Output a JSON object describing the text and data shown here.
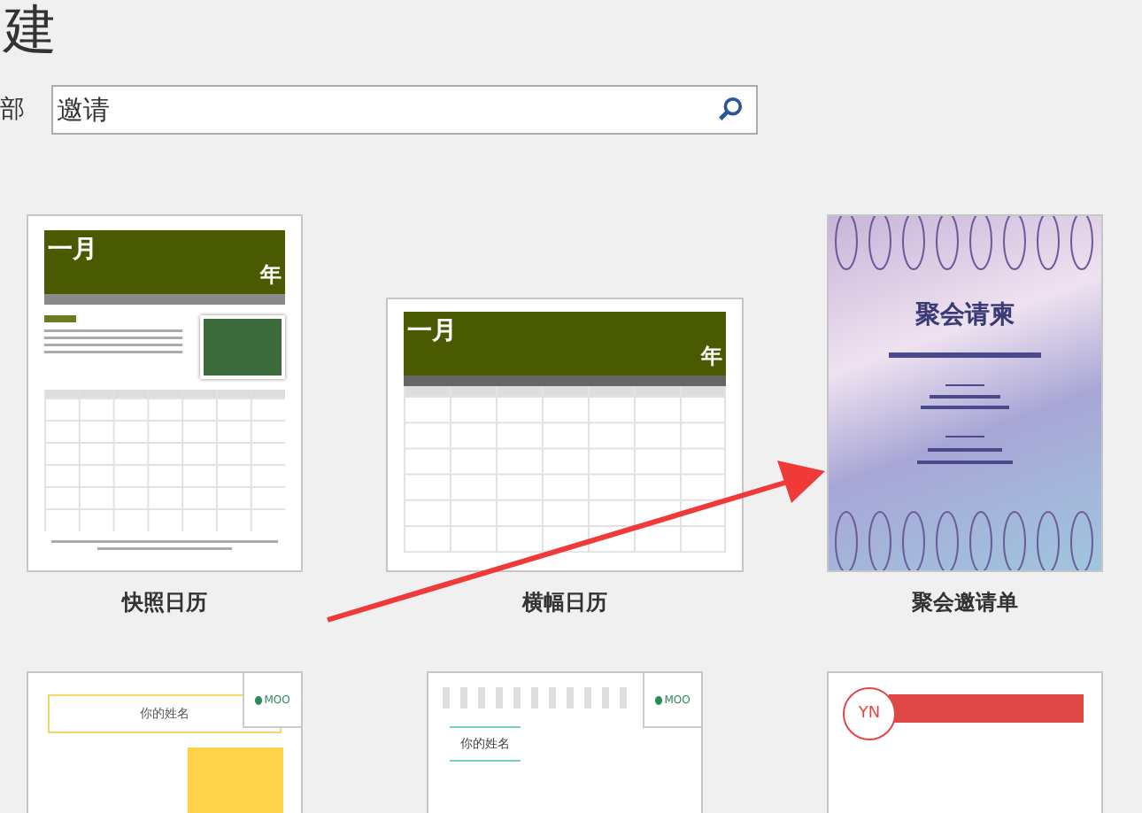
{
  "header": {
    "title": "建"
  },
  "search": {
    "scope_label": "部",
    "value": "邀请"
  },
  "templates": [
    {
      "kind": "photo_calendar",
      "name": "快照日历",
      "month": "一月",
      "year": "年"
    },
    {
      "kind": "banner_calendar",
      "name": "横幅日历",
      "month": "一月",
      "year": "年"
    },
    {
      "kind": "invitation",
      "name": "聚会邀请单",
      "heading": "聚会请柬"
    },
    {
      "kind": "resume_moo",
      "heading": "你的姓名",
      "logo": "MOO"
    },
    {
      "kind": "resume_moo_lines",
      "heading": "你的姓名",
      "logo": "MOO"
    },
    {
      "kind": "resume_red",
      "monogram": "YN"
    }
  ]
}
